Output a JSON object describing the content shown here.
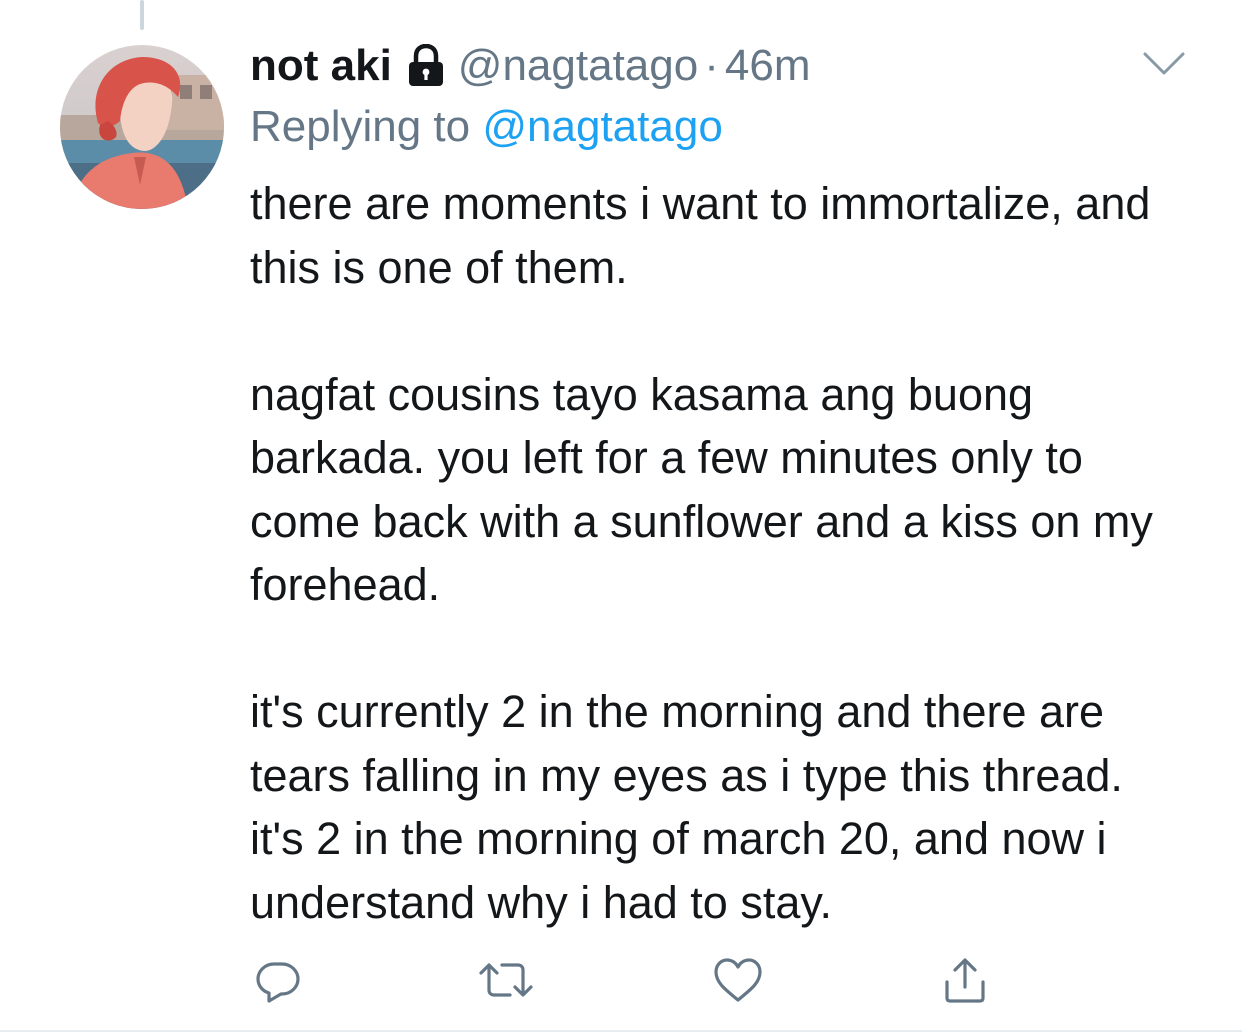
{
  "author": {
    "display_name": "not aki",
    "handle": "@nagtatago",
    "separator": "·",
    "time": "46m"
  },
  "reply": {
    "prefix": "Replying to",
    "handle": "@nagtatago"
  },
  "tweet": {
    "paragraphs": [
      "there are moments i want to immortalize, and this is one of them.",
      "nagfat cousins tayo kasama ang buong barkada. you left for a few minutes only to come back with a sunflower and a kiss on my forehead.",
      "it's currently 2 in the morning and there are tears falling in my eyes as i type this thread. it's 2 in the morning of march 20, and now i understand why i had to stay."
    ]
  },
  "icons": {
    "lock": "lock-icon",
    "chevron": "chevron-down-icon",
    "reply": "reply-icon",
    "retweet": "retweet-icon",
    "like": "heart-icon",
    "share": "share-icon"
  },
  "colors": {
    "text": "#14171a",
    "secondary": "#657786",
    "link": "#1da1f2",
    "icon": "#657786",
    "divider": "#e6ecf0"
  }
}
